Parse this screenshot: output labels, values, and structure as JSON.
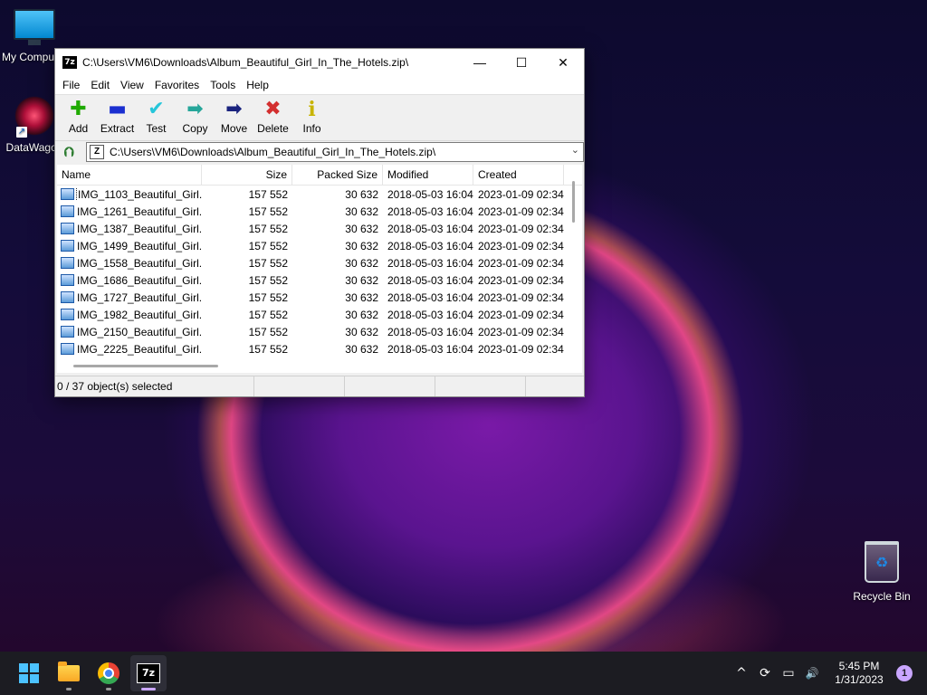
{
  "desktop": {
    "icons": [
      {
        "label": "My Computer"
      },
      {
        "label": "DataWagon"
      },
      {
        "label": "Recycle Bin"
      }
    ]
  },
  "window": {
    "title": "C:\\Users\\VM6\\Downloads\\Album_Beautiful_Girl_In_The_Hotels.zip\\",
    "app_icon": "7z",
    "controls": {
      "minimize": "—",
      "maximize": "☐",
      "close": "✕"
    },
    "menu": [
      "File",
      "Edit",
      "View",
      "Favorites",
      "Tools",
      "Help"
    ],
    "toolbar": [
      {
        "label": "Add",
        "icon": "add-plus-icon",
        "glyph": "✚",
        "color": "#1faa00"
      },
      {
        "label": "Extract",
        "icon": "extract-minus-icon",
        "glyph": "▬",
        "color": "#1a2fd0"
      },
      {
        "label": "Test",
        "icon": "test-check-icon",
        "glyph": "✔",
        "color": "#26c6da"
      },
      {
        "label": "Copy",
        "icon": "copy-arrow-icon",
        "glyph": "➡",
        "color": "#26a69a"
      },
      {
        "label": "Move",
        "icon": "move-arrow-icon",
        "glyph": "➡",
        "color": "#1a237e"
      },
      {
        "label": "Delete",
        "icon": "delete-x-icon",
        "glyph": "✖",
        "color": "#d32f2f"
      },
      {
        "label": "Info",
        "icon": "info-icon",
        "glyph": "i",
        "color": "#c8b400"
      }
    ],
    "address": {
      "path": "C:\\Users\\VM6\\Downloads\\Album_Beautiful_Girl_In_The_Hotels.zip\\"
    },
    "columns": [
      "Name",
      "Size",
      "Packed Size",
      "Modified",
      "Created"
    ],
    "files": [
      {
        "name": "IMG_1103_Beautiful_Girl...",
        "size": "157 552",
        "packed": "30 632",
        "modified": "2018-05-03 16:04",
        "created": "2023-01-09 02:34"
      },
      {
        "name": "IMG_1261_Beautiful_Girl...",
        "size": "157 552",
        "packed": "30 632",
        "modified": "2018-05-03 16:04",
        "created": "2023-01-09 02:34"
      },
      {
        "name": "IMG_1387_Beautiful_Girl...",
        "size": "157 552",
        "packed": "30 632",
        "modified": "2018-05-03 16:04",
        "created": "2023-01-09 02:34"
      },
      {
        "name": "IMG_1499_Beautiful_Girl...",
        "size": "157 552",
        "packed": "30 632",
        "modified": "2018-05-03 16:04",
        "created": "2023-01-09 02:34"
      },
      {
        "name": "IMG_1558_Beautiful_Girl...",
        "size": "157 552",
        "packed": "30 632",
        "modified": "2018-05-03 16:04",
        "created": "2023-01-09 02:34"
      },
      {
        "name": "IMG_1686_Beautiful_Girl...",
        "size": "157 552",
        "packed": "30 632",
        "modified": "2018-05-03 16:04",
        "created": "2023-01-09 02:34"
      },
      {
        "name": "IMG_1727_Beautiful_Girl...",
        "size": "157 552",
        "packed": "30 632",
        "modified": "2018-05-03 16:04",
        "created": "2023-01-09 02:34"
      },
      {
        "name": "IMG_1982_Beautiful_Girl...",
        "size": "157 552",
        "packed": "30 632",
        "modified": "2018-05-03 16:04",
        "created": "2023-01-09 02:34"
      },
      {
        "name": "IMG_2150_Beautiful_Girl...",
        "size": "157 552",
        "packed": "30 632",
        "modified": "2018-05-03 16:04",
        "created": "2023-01-09 02:34"
      },
      {
        "name": "IMG_2225_Beautiful_Girl...",
        "size": "157 552",
        "packed": "30 632",
        "modified": "2018-05-03 16:04",
        "created": "2023-01-09 02:34"
      }
    ],
    "status": {
      "selected": "0 / 37 object(s) selected"
    }
  },
  "taskbar": {
    "apps": [
      {
        "name": "start",
        "icon": "windows-start-icon"
      },
      {
        "name": "file-explorer",
        "icon": "folder-icon"
      },
      {
        "name": "chrome",
        "icon": "chrome-icon"
      },
      {
        "name": "7zip",
        "icon": "7zip-icon",
        "glyph": "7z"
      }
    ],
    "tray": {
      "chevron": "^",
      "sync": "⟳",
      "network": "▭",
      "volume": "🔊",
      "time": "5:45 PM",
      "date": "1/31/2023",
      "notifications": "1"
    }
  },
  "colors": {
    "accent": "#4cc2ff",
    "taskbar": "#1c1c22",
    "window_bg": "#f0f0f0"
  }
}
